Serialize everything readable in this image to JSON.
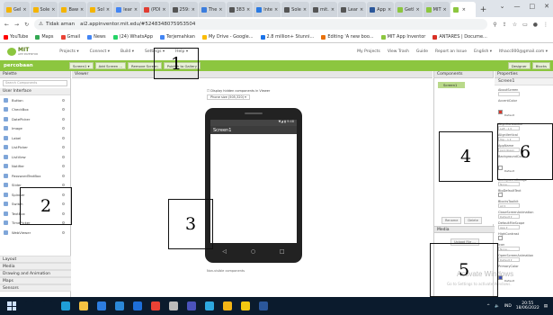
{
  "browser": {
    "tabs": [
      {
        "label": "Gel",
        "color": "#f4b400"
      },
      {
        "label": "Sole",
        "color": "#f4b400"
      },
      {
        "label": "Baw",
        "color": "#f4b400"
      },
      {
        "label": "Sol",
        "color": "#f4b400"
      },
      {
        "label": "lear",
        "color": "#4285f4"
      },
      {
        "label": "(PDI",
        "color": "#e03c31"
      },
      {
        "label": "259:",
        "color": "#555555"
      },
      {
        "label": "The",
        "color": "#3b7ddd"
      },
      {
        "label": "383",
        "color": "#555555"
      },
      {
        "label": "Inte",
        "color": "#2a7ae2"
      },
      {
        "label": "Sole",
        "color": "#555555"
      },
      {
        "label": "mit.",
        "color": "#555555"
      },
      {
        "label": "Lear",
        "color": "#555555"
      },
      {
        "label": "App",
        "color": "#2b579a"
      },
      {
        "label": "Getl",
        "color": "#8cc63f"
      },
      {
        "label": "MIT",
        "color": "#8cc63f"
      },
      {
        "label": "",
        "color": "#8cc63f"
      }
    ],
    "new_tab": "+",
    "window_controls": [
      "⌄",
      "—",
      "□",
      "✕"
    ],
    "address": {
      "security": "Tidak aman",
      "url": "ai2.appinventor.mit.edu/#5248348075953504"
    },
    "bookmarks": [
      {
        "label": "YouTube",
        "color": "#ff0000"
      },
      {
        "label": "Maps",
        "color": "#34a853"
      },
      {
        "label": "Gmail",
        "color": "#ea4335"
      },
      {
        "label": "News",
        "color": "#4285f4"
      },
      {
        "label": "(24) WhatsApp",
        "color": "#25d366"
      },
      {
        "label": "Terjemahkan",
        "color": "#4285f4"
      },
      {
        "label": "My Drive - Google...",
        "color": "#fbbc04"
      },
      {
        "label": "2.8 million+ Stunni...",
        "color": "#1a73e8"
      },
      {
        "label": "Editing 'A new boo...",
        "color": "#e8710a"
      },
      {
        "label": "MIT App Inventor",
        "color": "#8cc63f"
      },
      {
        "label": "ANTARES | Docume...",
        "color": "#d93025"
      }
    ]
  },
  "appinventor": {
    "logo_text": "MIT",
    "logo_sub": "APP INVENTOR",
    "menus": [
      "Projects ▾",
      "Connect ▾",
      "Build ▾",
      "Settings ▾",
      "Help ▾"
    ],
    "right_links": [
      "My Projects",
      "View Trash",
      "Guide",
      "Report an Issue",
      "English ▾",
      "Ithacc000@gmail.com ▾"
    ],
    "project_name": "percobaan",
    "toolbar": [
      "Screen1 ▾",
      "Add Screen ...",
      "Remove Screen",
      "Publish to Gallery"
    ],
    "toolbar_right": [
      "Designer",
      "Blocks"
    ]
  },
  "palette": {
    "header": "Palette",
    "search_placeholder": "Search Components",
    "category": "User Interface",
    "items": [
      "Button",
      "CheckBox",
      "DatePicker",
      "Image",
      "Label",
      "ListPicker",
      "ListView",
      "Notifier",
      "PasswordTextBox",
      "Slider",
      "Spinner",
      "Switch",
      "TextBox",
      "TimePicker",
      "WebViewer"
    ],
    "bottom_categories": [
      "Layout",
      "Media",
      "Drawing and Animation",
      "Maps",
      "Sensors"
    ]
  },
  "viewer": {
    "header": "Viewer",
    "checkbox_label": "Display hidden components in Viewer",
    "size_select": "Phone size (505,320) ▾",
    "status_text": "▼◢ ▮ 9:48",
    "screen_title": "Screen1",
    "nav": [
      "◁",
      "○",
      "□"
    ],
    "non_visible": "Non-visible components"
  },
  "components": {
    "header": "Components",
    "root": "Screen1",
    "buttons": [
      "Rename",
      "Delete"
    ],
    "media_header": "Media",
    "upload_button": "Upload File ..."
  },
  "properties": {
    "header": "Properties",
    "component_name": "Screen1",
    "rows": [
      {
        "label": "AboutScreen",
        "kind": "box",
        "value": ""
      },
      {
        "label": "AccentColor",
        "kind": "color",
        "value": "Default",
        "color": "#d9362b"
      },
      {
        "label": "AlignHorizontal",
        "kind": "box",
        "value": "Left : 1 ▾"
      },
      {
        "label": "AlignVertical",
        "kind": "box",
        "value": "Top : 1 ▾"
      },
      {
        "label": "AppName",
        "kind": "box",
        "value": "percobaan"
      },
      {
        "label": "BackgroundColor",
        "kind": "color",
        "value": "Default",
        "color": "#ffffff"
      },
      {
        "label": "BackgroundImage",
        "kind": "box",
        "value": "None..."
      },
      {
        "label": "BigDefaultText",
        "kind": "check",
        "value": ""
      },
      {
        "label": "BlocksToolkit",
        "kind": "box",
        "value": "All ▾"
      },
      {
        "label": "CloseScreenAnimation",
        "kind": "box",
        "value": "Default ▾"
      },
      {
        "label": "DefaultFileScope",
        "kind": "box",
        "value": "App ▾"
      },
      {
        "label": "HighContrast",
        "kind": "check",
        "value": ""
      },
      {
        "label": "Icon",
        "kind": "box",
        "value": "None..."
      },
      {
        "label": "OpenScreenAnimation",
        "kind": "box",
        "value": "Default ▾"
      },
      {
        "label": "PrimaryColor",
        "kind": "color",
        "value": "Default",
        "color": "#3f51b5"
      }
    ]
  },
  "watermark": {
    "title": "Activate Windows",
    "subtitle": "Go to Settings to activate Windows."
  },
  "taskbar": {
    "icons": [
      {
        "name": "search-icon",
        "color": "#0b1b2d"
      },
      {
        "name": "task-view-icon",
        "color": "#0b1b2d"
      },
      {
        "name": "edge-icon",
        "color": "#1f9ed8"
      },
      {
        "name": "explorer-icon",
        "color": "#f5c242"
      },
      {
        "name": "store-icon",
        "color": "#2d7de0"
      },
      {
        "name": "mail-icon",
        "color": "#2b88d8"
      },
      {
        "name": "calendar-icon",
        "color": "#1e6fd9"
      },
      {
        "name": "chrome-icon",
        "color": "#e94235"
      },
      {
        "name": "settings-icon",
        "color": "#bbbbbb"
      },
      {
        "name": "teams-icon",
        "color": "#4b53bc"
      },
      {
        "name": "photos-icon",
        "color": "#2ea8e0"
      },
      {
        "name": "chrome-alt-icon",
        "color": "#f3b516"
      },
      {
        "name": "file-icon",
        "color": "#f2c811"
      },
      {
        "name": "word-icon",
        "color": "#2b579a"
      }
    ],
    "tray": [
      "^",
      "🔈",
      "IND"
    ],
    "time": "20:55",
    "date": "18/06/2022"
  },
  "annotations": [
    {
      "label": "1",
      "color": "#000000"
    },
    {
      "label": "2",
      "color": "#000000"
    },
    {
      "label": "3",
      "color": "#000000"
    },
    {
      "label": "4",
      "color": "#000000"
    },
    {
      "label": "5",
      "color": "#000000"
    },
    {
      "label": "6",
      "color": "#000000"
    }
  ]
}
